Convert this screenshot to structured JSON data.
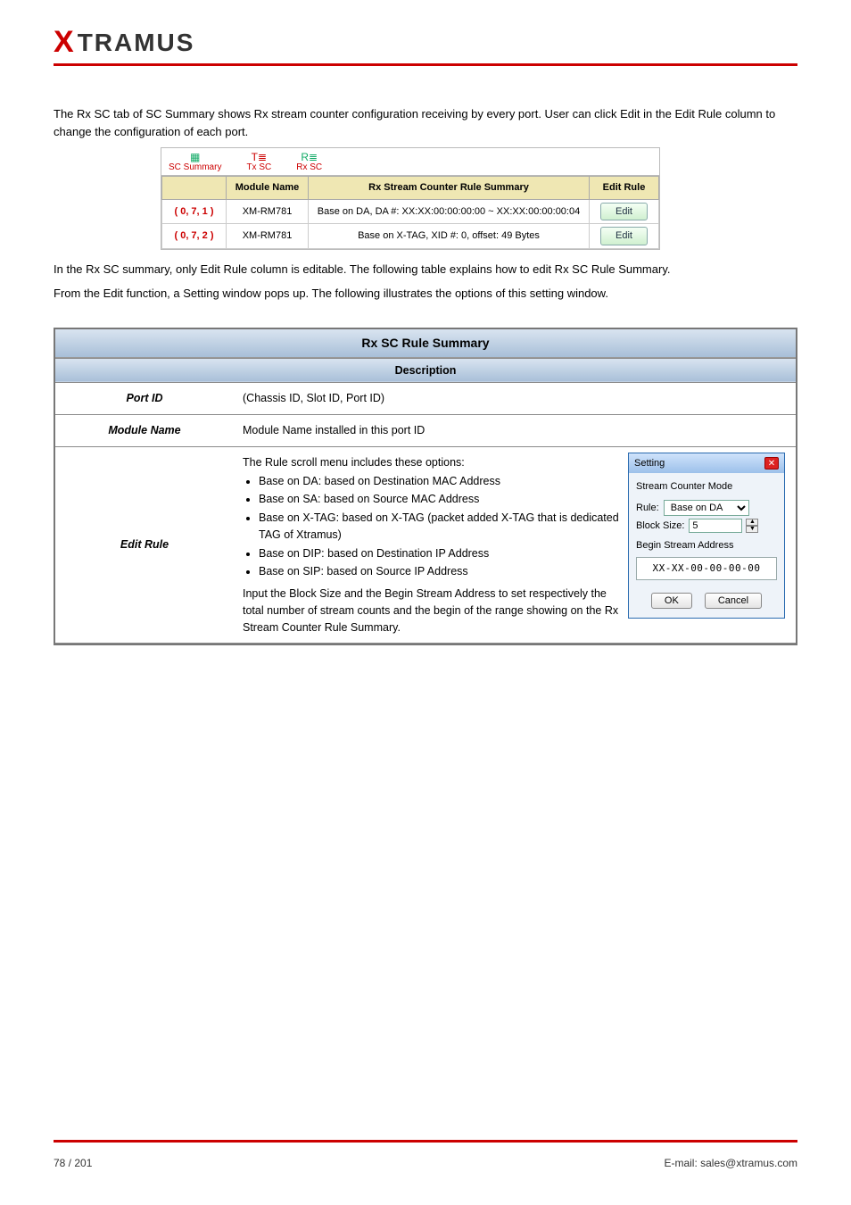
{
  "logo": {
    "text": "TRAMUS",
    "x": "X"
  },
  "intro1": "The Rx SC tab of SC Summary shows Rx stream counter configuration receiving by every port. User can click Edit in the Edit Rule column to change the configuration of each port.",
  "sc_toolbar": {
    "summary": "SC Summary",
    "txsc": "Tx SC",
    "rxsc": "Rx SC"
  },
  "sc_header": {
    "port": "",
    "module": "Module Name",
    "summary": "Rx Stream Counter Rule Summary",
    "edit": "Edit Rule"
  },
  "sc_rows": [
    {
      "port": "( 0, 7, 1 )",
      "module": "XM-RM781",
      "summary": "Base on DA, DA #: XX:XX:00:00:00:00 ~ XX:XX:00:00:00:04",
      "edit": "Edit"
    },
    {
      "port": "( 0, 7, 2 )",
      "module": "XM-RM781",
      "summary": "Base on X-TAG, XID #: 0, offset: 49 Bytes",
      "edit": "Edit"
    }
  ],
  "intro2_a": "In the Rx SC summary, only Edit Rule column is editable. The following table explains how to edit Rx SC Rule Summary.",
  "intro2_b": "From the Edit function, a Setting window pops up. The following illustrates the options of this setting window.",
  "def": {
    "title": "Rx SC Rule Summary",
    "col_head": "Description",
    "rows": [
      {
        "left": "Port ID",
        "right": "(Chassis ID, Slot ID, Port ID)"
      },
      {
        "left": "Module Name",
        "right": "Module Name installed in this port ID"
      }
    ],
    "edit_left": "Edit Rule",
    "edit_lead": "The Rule scroll menu includes these options:",
    "edit_bullets": [
      "Base on DA: based on Destination MAC Address",
      "Base on SA: based on Source MAC Address",
      "Base on X-TAG: based on X-TAG (packet added X-TAG that is dedicated TAG of Xtramus)",
      "Base on DIP: based on Destination IP Address",
      "Base on SIP: based on Source IP Address"
    ],
    "edit_tail": "Input the Block Size and the Begin Stream Address to set respectively the total number of stream counts and the begin of the range showing on the Rx Stream Counter Rule Summary."
  },
  "dialog": {
    "title": "Setting",
    "section": "Stream Counter Mode",
    "rule_label": "Rule:",
    "rule_value": "Base on DA",
    "block_label": "Block Size:",
    "block_value": "5",
    "addr_label": "Begin Stream Address",
    "addr_value": "XX-XX-00-00-00-00",
    "ok": "OK",
    "cancel": "Cancel"
  },
  "footer": {
    "left": "78 / 201",
    "right": "E-mail: sales@xtramus.com"
  }
}
